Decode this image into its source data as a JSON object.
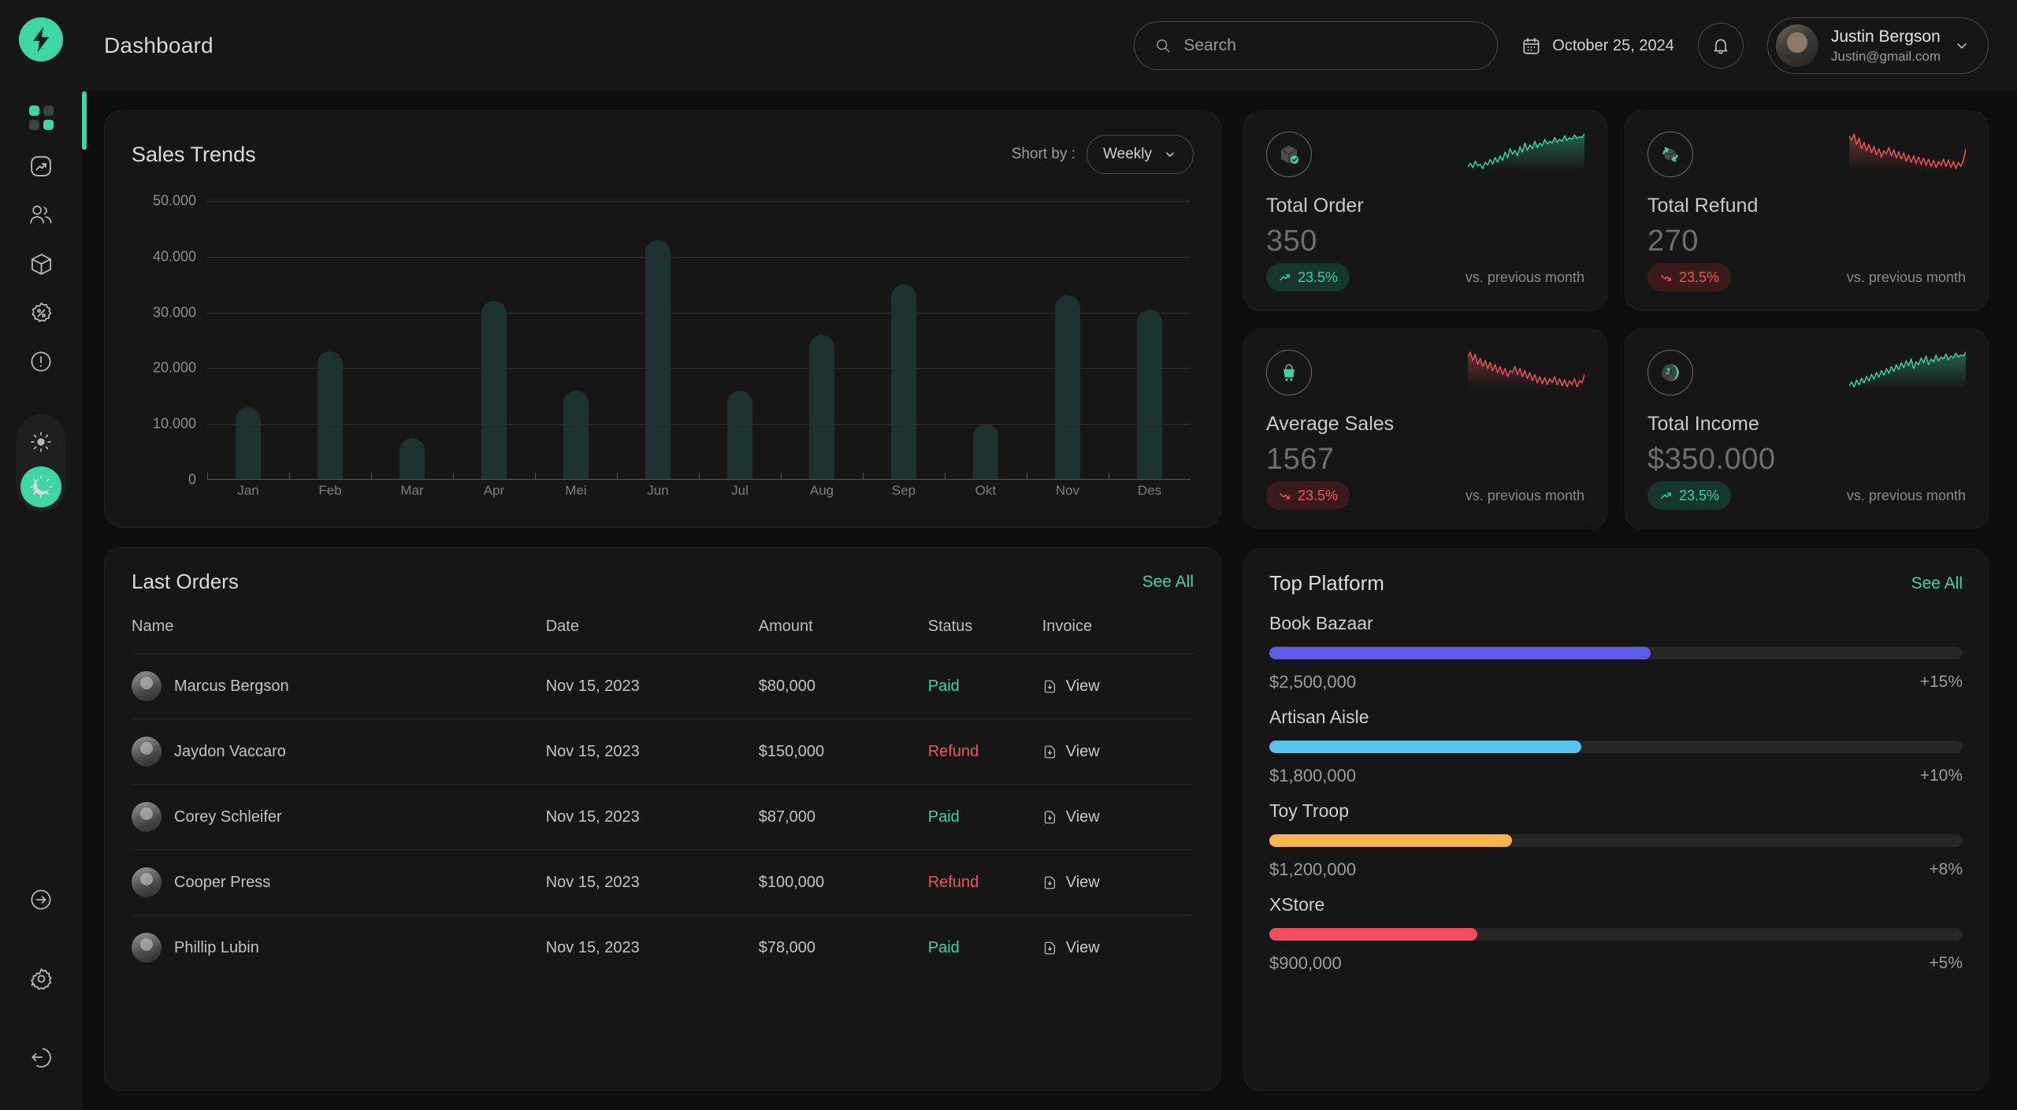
{
  "brand": {
    "logo_icon": "bolt-icon",
    "accent": "#3ed6a5"
  },
  "header": {
    "title": "Dashboard",
    "search": {
      "placeholder": "Search",
      "value": "",
      "icon": "search-icon"
    },
    "date": {
      "label": "October 25, 2024",
      "icon": "calendar-icon"
    },
    "notification_icon": "bell-icon",
    "profile": {
      "name": "Justin Bergson",
      "email": "Justin@gmail.com",
      "chevron": "chevron-down-icon"
    }
  },
  "sidebar": {
    "items": [
      {
        "name": "dashboard",
        "icon": "grid-icon",
        "active": true
      },
      {
        "name": "analytics",
        "icon": "trending-up-icon",
        "active": false
      },
      {
        "name": "customers",
        "icon": "users-icon",
        "active": false
      },
      {
        "name": "products",
        "icon": "package-icon",
        "active": false
      },
      {
        "name": "discounts",
        "icon": "discount-badge-icon",
        "active": false
      },
      {
        "name": "alerts",
        "icon": "alert-circle-icon",
        "active": false
      }
    ],
    "theme_toggle": {
      "light_icon": "sun-icon",
      "dark_icon": "moon-icon",
      "active": "dark"
    },
    "bottom_items": [
      {
        "name": "expand",
        "icon": "arrow-right-circle-icon"
      },
      {
        "name": "settings",
        "icon": "gear-icon"
      },
      {
        "name": "logout",
        "icon": "logout-icon"
      }
    ]
  },
  "sales_trends": {
    "title": "Sales Trends",
    "sort_label": "Short by :",
    "sort_value": "Weekly",
    "sort_chevron": "chevron-down-icon"
  },
  "chart_data": {
    "type": "bar",
    "title": "Sales Trends",
    "categories": [
      "Jan",
      "Feb",
      "Mar",
      "Apr",
      "Mei",
      "Jun",
      "Jul",
      "Aug",
      "Sep",
      "Okt",
      "Nov",
      "Des"
    ],
    "values": [
      13000,
      23000,
      7500,
      32000,
      16000,
      43000,
      16000,
      26000,
      35000,
      10000,
      33000,
      30500
    ],
    "ytick_labels": [
      "0",
      "10.000",
      "20.000",
      "30.000",
      "40.000",
      "50.000"
    ],
    "yticks": [
      0,
      10000,
      20000,
      30000,
      40000,
      50000
    ],
    "ylim": [
      0,
      50000
    ],
    "xlabel": "",
    "ylabel": "",
    "grid": true,
    "legend": false,
    "bar_color": "#1d322e"
  },
  "stats": [
    {
      "name": "total-order",
      "icon": "box-check-icon",
      "label": "Total Order",
      "value": "350",
      "change": "23.5%",
      "direction": "up",
      "compare": "vs. previous month",
      "spark_color": "#3ed6a5",
      "spark": [
        10,
        14,
        9,
        16,
        11,
        13,
        8,
        15,
        12,
        18,
        13,
        20,
        15,
        22,
        17,
        26,
        20,
        30,
        24,
        28,
        22,
        32,
        26,
        36,
        28,
        34,
        30,
        38,
        31,
        36,
        33,
        40,
        35,
        38,
        36,
        42,
        37,
        40,
        38,
        44,
        39,
        42,
        40,
        45,
        41,
        43,
        42,
        46
      ]
    },
    {
      "name": "total-refund",
      "icon": "refund-box-icon",
      "label": "Total Refund",
      "value": "270",
      "change": "23.5%",
      "direction": "down",
      "compare": "vs. previous month",
      "spark_color": "#f2545b",
      "spark": [
        42,
        38,
        44,
        34,
        40,
        30,
        36,
        28,
        34,
        26,
        32,
        24,
        30,
        22,
        28,
        25,
        31,
        23,
        29,
        21,
        27,
        20,
        26,
        18,
        24,
        17,
        23,
        16,
        22,
        15,
        21,
        14,
        20,
        13,
        19,
        12,
        18,
        14,
        20,
        13,
        19,
        12,
        18,
        11,
        17,
        13,
        19,
        30
      ]
    },
    {
      "name": "average-sales",
      "icon": "cart-icon",
      "label": "Average Sales",
      "value": "1567",
      "change": "23.5%",
      "direction": "down",
      "compare": "vs. previous month",
      "spark_color": "#f2545b",
      "spark": [
        40,
        44,
        36,
        42,
        32,
        38,
        30,
        36,
        28,
        34,
        26,
        32,
        24,
        30,
        22,
        28,
        20,
        26,
        24,
        30,
        22,
        28,
        20,
        26,
        18,
        24,
        16,
        22,
        14,
        20,
        13,
        19,
        12,
        18,
        14,
        20,
        12,
        18,
        11,
        17,
        10,
        16,
        12,
        18,
        10,
        16,
        14,
        22
      ]
    },
    {
      "name": "total-income",
      "icon": "dollar-coin-icon",
      "label": "Total Income",
      "value": "$350.000",
      "change": "23.5%",
      "direction": "up",
      "compare": "vs. previous month",
      "spark_color": "#3ed6a5",
      "spark": [
        12,
        16,
        11,
        18,
        13,
        20,
        15,
        22,
        17,
        24,
        19,
        26,
        21,
        28,
        23,
        30,
        25,
        32,
        27,
        34,
        29,
        36,
        31,
        38,
        33,
        40,
        30,
        37,
        34,
        41,
        36,
        43,
        34,
        40,
        37,
        44,
        38,
        42,
        40,
        45,
        39,
        43,
        41,
        46,
        42,
        44,
        43,
        47
      ]
    }
  ],
  "last_orders": {
    "title": "Last Orders",
    "see_all": "See All",
    "columns": [
      "Name",
      "Date",
      "Amount",
      "Status",
      "Invoice"
    ],
    "invoice_action": "View",
    "invoice_icon": "download-file-icon",
    "rows": [
      {
        "name": "Marcus Bergson",
        "date": "Nov 15, 2023",
        "amount": "$80,000",
        "status": "Paid",
        "invoice": "View"
      },
      {
        "name": "Jaydon Vaccaro",
        "date": "Nov 15, 2023",
        "amount": "$150,000",
        "status": "Refund",
        "invoice": "View"
      },
      {
        "name": "Corey Schleifer",
        "date": "Nov 15, 2023",
        "amount": "$87,000",
        "status": "Paid",
        "invoice": "View"
      },
      {
        "name": "Cooper Press",
        "date": "Nov 15, 2023",
        "amount": "$100,000",
        "status": "Refund",
        "invoice": "View"
      },
      {
        "name": "Phillip Lubin",
        "date": "Nov 15, 2023",
        "amount": "$78,000",
        "status": "Paid",
        "invoice": "View"
      }
    ]
  },
  "top_platform": {
    "title": "Top Platform",
    "see_all": "See All",
    "items": [
      {
        "name": "Book Bazaar",
        "amount": "$2,500,000",
        "growth": "+15%",
        "percent": 55,
        "color": "#5b5be8"
      },
      {
        "name": "Artisan Aisle",
        "amount": "$1,800,000",
        "growth": "+10%",
        "percent": 45,
        "color": "#56c4ee"
      },
      {
        "name": "Toy Troop",
        "amount": "$1,200,000",
        "growth": "+8%",
        "percent": 35,
        "color": "#fbb34a"
      },
      {
        "name": "XStore",
        "amount": "$900,000",
        "growth": "+5%",
        "percent": 30,
        "color": "#f54c5e"
      }
    ]
  }
}
